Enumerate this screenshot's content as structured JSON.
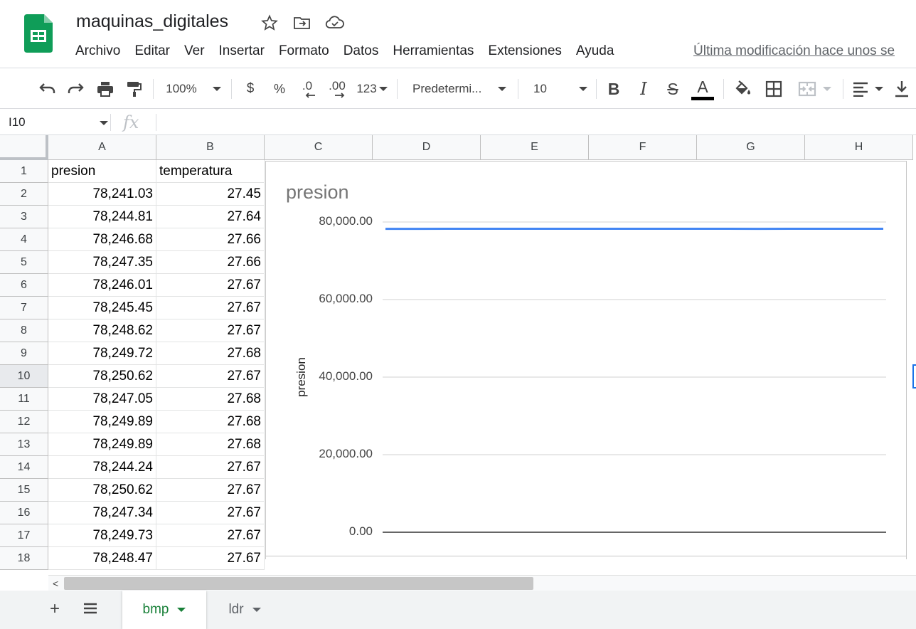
{
  "app": {
    "title": "maquinas_digitales",
    "last_modified": "Última modificación hace unos se",
    "menu": [
      "Archivo",
      "Editar",
      "Ver",
      "Insertar",
      "Formato",
      "Datos",
      "Herramientas",
      "Extensiones",
      "Ayuda"
    ]
  },
  "toolbar": {
    "zoom": "100%",
    "currency": "$",
    "percent": "%",
    "decrease_decimals": ".0",
    "increase_decimals": ".00",
    "more_formats": "123",
    "font": "Predetermi...",
    "font_size": "10",
    "bold": "B",
    "italic": "I",
    "strike": "S",
    "text_color": "A"
  },
  "formula_bar": {
    "name_box": "I10",
    "fx": "fx",
    "value": ""
  },
  "grid": {
    "columns": [
      "A",
      "B",
      "C",
      "D",
      "E",
      "F",
      "G",
      "H"
    ],
    "rows": [
      "1",
      "2",
      "3",
      "4",
      "5",
      "6",
      "7",
      "8",
      "9",
      "10",
      "11",
      "12",
      "13",
      "14",
      "15",
      "16",
      "17",
      "18"
    ],
    "active_row": "10",
    "headers": {
      "a1": "presion",
      "b1": "temperatura"
    },
    "presion": [
      "78,241.03",
      "78,244.81",
      "78,246.68",
      "78,247.35",
      "78,246.01",
      "78,245.45",
      "78,248.62",
      "78,249.72",
      "78,250.62",
      "78,247.05",
      "78,249.89",
      "78,249.89",
      "78,244.24",
      "78,250.62",
      "78,247.34",
      "78,249.73",
      "78,248.47"
    ],
    "temperatura": [
      "27.45",
      "27.64",
      "27.66",
      "27.66",
      "27.67",
      "27.67",
      "27.67",
      "27.68",
      "27.67",
      "27.68",
      "27.68",
      "27.68",
      "27.67",
      "27.67",
      "27.67",
      "27.67",
      "27.67"
    ]
  },
  "chart_data": {
    "type": "line",
    "title": "presion",
    "ylabel": "presion",
    "xlabel": "",
    "ylim": [
      0,
      80000
    ],
    "yticks": [
      "80,000.00",
      "60,000.00",
      "40,000.00",
      "20,000.00",
      "0.00"
    ],
    "grid": true,
    "series": [
      {
        "name": "presion",
        "color": "#4285f4",
        "values": [
          78241.03,
          78244.81,
          78246.68,
          78247.35,
          78246.01,
          78245.45,
          78248.62,
          78249.72,
          78250.62,
          78247.05,
          78249.89,
          78249.89,
          78244.24,
          78250.62,
          78247.34,
          78249.73,
          78248.47
        ]
      }
    ]
  },
  "sheets": [
    {
      "label": "bmp",
      "active": true
    },
    {
      "label": "ldr",
      "active": false
    }
  ],
  "colors": {
    "accent_green": "#188038",
    "series_blue": "#4285f4",
    "selection_blue": "#1a73e8"
  }
}
